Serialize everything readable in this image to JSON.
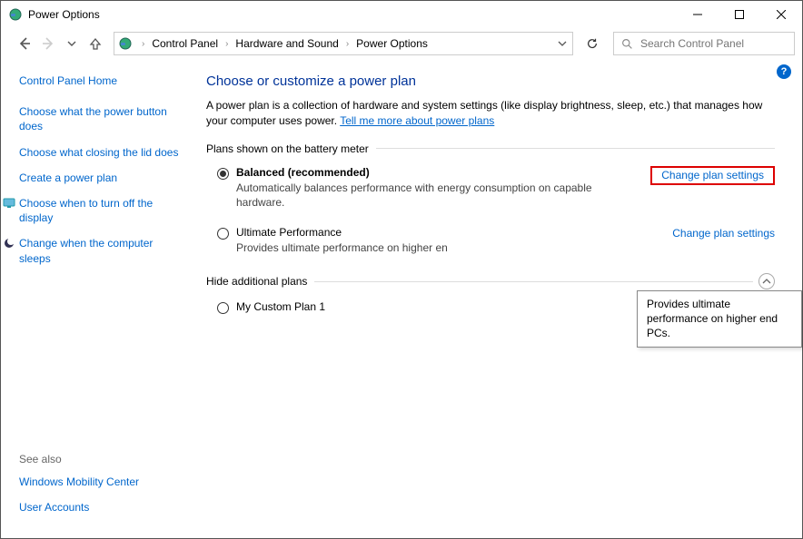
{
  "window": {
    "title": "Power Options"
  },
  "breadcrumb": {
    "items": [
      "Control Panel",
      "Hardware and Sound",
      "Power Options"
    ]
  },
  "search": {
    "placeholder": "Search Control Panel"
  },
  "sidebar": {
    "home": "Control Panel Home",
    "links": [
      "Choose what the power button does",
      "Choose what closing the lid does",
      "Create a power plan",
      "Choose when to turn off the display",
      "Change when the computer sleeps"
    ],
    "see_also_heading": "See also",
    "see_also": [
      "Windows Mobility Center",
      "User Accounts"
    ]
  },
  "main": {
    "heading": "Choose or customize a power plan",
    "intro_text_a": "A power plan is a collection of hardware and system settings (like display brightness, sleep, etc.) that manages how your computer uses power. ",
    "intro_link": "Tell me more about power plans",
    "plans_label": "Plans shown on the battery meter",
    "hide_label": "Hide additional plans",
    "change_link": "Change plan settings",
    "plans": [
      {
        "name": "Balanced (recommended)",
        "desc": "Automatically balances performance with energy consumption on capable hardware.",
        "selected": true
      },
      {
        "name": "Ultimate Performance",
        "desc": "Provides ultimate performance on higher end PCs.",
        "selected": false
      }
    ],
    "additional_plans": [
      {
        "name": "My Custom Plan 1",
        "desc": "",
        "selected": false
      }
    ]
  },
  "tooltip": {
    "text": "Provides ultimate performance on higher end PCs."
  }
}
